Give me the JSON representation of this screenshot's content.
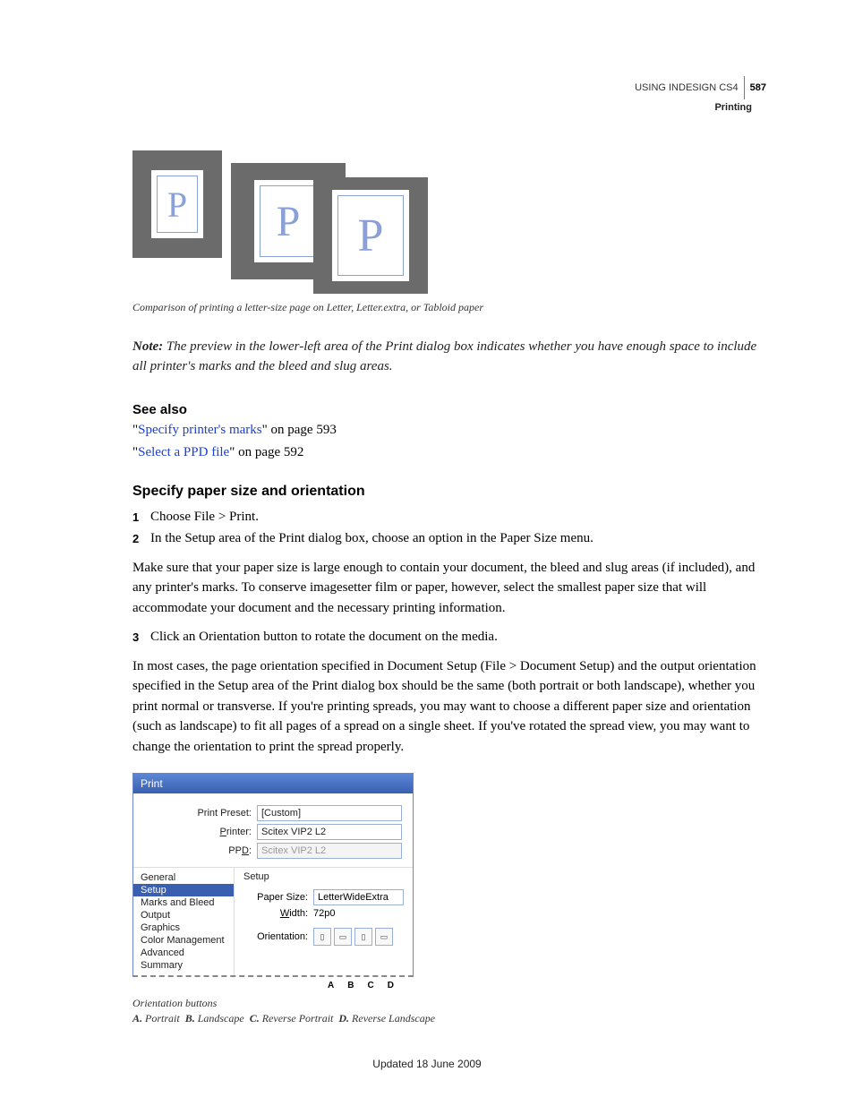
{
  "header": {
    "using": "USING INDESIGN CS4",
    "page_number": "587",
    "section": "Printing"
  },
  "figure1": {
    "glyph": "P",
    "caption": "Comparison of printing a letter-size page on Letter, Letter.extra, or Tabloid paper"
  },
  "note": {
    "label": "Note:",
    "text": "The preview in the lower-left area of the Print dialog box indicates whether you have enough space to include all printer's marks and the bleed and slug areas."
  },
  "see_also": {
    "heading": "See also",
    "links": [
      {
        "text": "Specify printer's marks",
        "suffix": "\" on page 593"
      },
      {
        "text": "Select a PPD file",
        "suffix": "\" on page 592"
      }
    ]
  },
  "section": {
    "heading": "Specify paper size and orientation",
    "step1_num": "1",
    "step1_text": "Choose File > Print.",
    "step2_num": "2",
    "step2_text": "In the Setup area of the Print dialog box, choose an option in the Paper Size menu.",
    "body1": "Make sure that your paper size is large enough to contain your document, the bleed and slug areas (if included), and any printer's marks. To conserve imagesetter film or paper, however, select the smallest paper size that will accommodate your document and the necessary printing information.",
    "step3_num": "3",
    "step3_text": "Click an Orientation button to rotate the document on the media.",
    "body2": "In most cases, the page orientation specified in Document Setup (File > Document Setup) and the output orientation specified in the Setup area of the Print dialog box should be the same (both portrait or both landscape), whether you print normal or transverse. If you're printing spreads, you may want to choose a different paper size and orientation (such as landscape) to fit all pages of a spread on a single sheet. If you've rotated the spread view, you may want to change the orientation to print the spread properly."
  },
  "dialog": {
    "title": "Print",
    "labels": {
      "preset": "Print Preset:",
      "printer": "Printer:",
      "ppd": "PPD:",
      "paper_size": "Paper Size:",
      "width": "Width:",
      "orientation": "Orientation:"
    },
    "values": {
      "preset": "[Custom]",
      "printer": "Scitex VIP2 L2",
      "ppd": "Scitex VIP2 L2",
      "paper_size": "LetterWideExtra",
      "width": "72p0"
    },
    "printer_underline": "P",
    "ppd_underline": "D",
    "width_underline": "W",
    "nav": [
      "General",
      "Setup",
      "Marks and Bleed",
      "Output",
      "Graphics",
      "Color Management",
      "Advanced",
      "Summary"
    ],
    "panel_header": "Setup"
  },
  "legend": {
    "letters": [
      "A",
      "B",
      "C",
      "D"
    ],
    "caption_title": "Orientation buttons",
    "a_label": "A.",
    "a_text": "Portrait",
    "b_label": "B.",
    "b_text": "Landscape",
    "c_label": "C.",
    "c_text": "Reverse Portrait",
    "d_label": "D.",
    "d_text": "Reverse Landscape"
  },
  "footer": "Updated 18 June 2009",
  "quote": "\""
}
